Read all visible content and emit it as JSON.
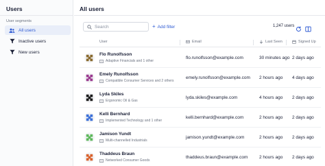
{
  "sidebar": {
    "title": "Users",
    "section_label": "User segments",
    "segments": [
      {
        "label": "All users",
        "icon": "users-icon",
        "active": true
      },
      {
        "label": "Inactive users",
        "icon": "filter-icon",
        "active": false
      },
      {
        "label": "New users",
        "icon": "filter-icon",
        "active": false
      }
    ]
  },
  "main": {
    "title": "All users",
    "search_placeholder": "Search",
    "add_filter_label": "Add filter",
    "user_count": "1,247 users"
  },
  "table": {
    "columns": {
      "user": "User",
      "email": "Email",
      "last_seen": "Last Seen",
      "signed_up": "Signed Up"
    },
    "rows": [
      {
        "name": "Flo Runolfsson",
        "company": "Adaptive Financials and 1 other",
        "email": "flo.runolfsson@example.com",
        "last_seen": "30 minutes ago",
        "signed_up": "2 days ago",
        "avatar_color": "#8a6a2e"
      },
      {
        "name": "Emely Runolfsson",
        "company": "Compatible Consumer Services and 2 others",
        "email": "emely.runolfsson@example.com",
        "last_seen": "2 hours ago",
        "signed_up": "4 days ago",
        "avatar_color": "#9b3a8f"
      },
      {
        "name": "Lyda Skiles",
        "company": "Ergonomic Oil & Gas",
        "email": "lyda.skiles@example.com",
        "last_seen": "4 hours ago",
        "signed_up": "2 days ago",
        "avatar_color": "#1c1c1c"
      },
      {
        "name": "Kelli Bernhard",
        "company": "Implemented Technology and 1 other",
        "email": "kelli.bernhard@example.com",
        "last_seen": "2 hours ago",
        "signed_up": "2 days ago",
        "avatar_color": "#3b6fd8"
      },
      {
        "name": "Jamison Yundt",
        "company": "Multi-channelled Industrials",
        "email": "jamison.yundt@example.com",
        "last_seen": "2 hours ago",
        "signed_up": "2 days ago",
        "avatar_color": "#5db85a"
      },
      {
        "name": "Thaddeus Braun",
        "company": "Networked Consumer Goods",
        "email": "thaddeus.braun@example.com",
        "last_seen": "2 hours ago",
        "signed_up": "2 days ago",
        "avatar_color": "#d9602a"
      }
    ]
  }
}
